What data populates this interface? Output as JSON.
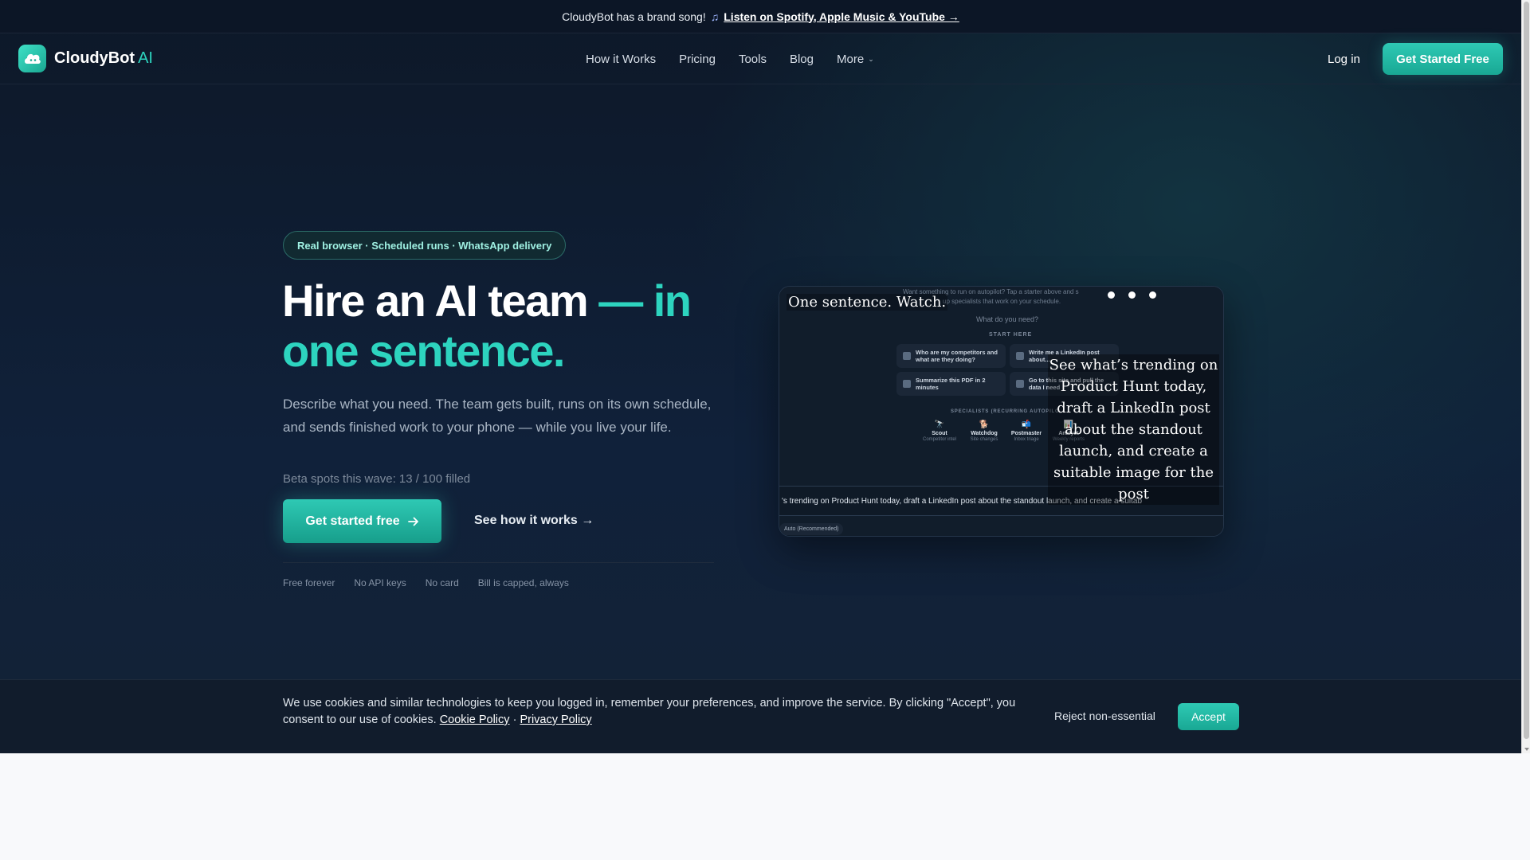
{
  "announcement": {
    "text": "CloudyBot has a brand song!",
    "icon": "music-note-icon",
    "link": "Listen on Spotify, Apple Music & YouTube →"
  },
  "nav": {
    "logo_text": "CloudyBot",
    "logo_suffix": "AI",
    "links": [
      "How it Works",
      "Pricing",
      "Tools",
      "Blog",
      "More"
    ],
    "login": "Log in",
    "cta": "Get Started Free"
  },
  "hero": {
    "badge": "Real browser · Scheduled runs · WhatsApp delivery",
    "headline_main": "Hire an AI team",
    "headline_accent": "— in one sentence.",
    "subtext": "Describe what you need. The team gets built, runs on its own schedule, and sends finished work to your phone — while you live your life.",
    "beta": "Beta spots this wave: 13 / 100 filled",
    "cta_primary": "Get started free",
    "cta_secondary": "See how it works →",
    "perks": [
      "Free forever",
      "No API keys",
      "No card",
      "Bill is capped, always"
    ]
  },
  "preview": {
    "intro_line1": "Want something to run on autopilot? Tap a starter above and s",
    "intro_line2": "up specialists that work on your schedule.",
    "question": "What do you need?",
    "start_here": "START HERE",
    "starters": [
      "Who are my competitors and what are they doing?",
      "Write me a LinkedIn post about...",
      "Summarize this PDF in 2 minutes",
      "Go to this site and pull the data I need"
    ],
    "specialists_label": "SPECIALISTS (RECURRING AUTOPILO",
    "specialists": [
      {
        "name": "Scout",
        "sub": "Competitor intel"
      },
      {
        "name": "Watchdog",
        "sub": "Site changes"
      },
      {
        "name": "Postmaster",
        "sub": "Inbox triage"
      },
      {
        "name": "Analyst",
        "sub": "Weekly reports"
      }
    ],
    "prompt": "'s trending on Product Hunt today, draft a LinkedIn post about the standout launch, and create a suitab",
    "model": "Auto (Recommended)",
    "caption_left": "One sentence. Watch.",
    "caption_right": "See what’s trending on Product Hunt today, draft a LinkedIn post about the standout launch, and create a suitable image for the post"
  },
  "cookie": {
    "text": "We use cookies and similar technologies to keep you logged in, remember your preferences, and improve the service. By clicking \"Accept\", you consent to our use of cookies.",
    "cookie_policy": "Cookie Policy",
    "separator": "·",
    "privacy_policy": "Privacy Policy",
    "reject": "Reject non-essential",
    "accept": "Accept"
  },
  "colors": {
    "accent": "#2dd4bf",
    "background": "#0d1828",
    "cta": "#1fb8a3"
  }
}
